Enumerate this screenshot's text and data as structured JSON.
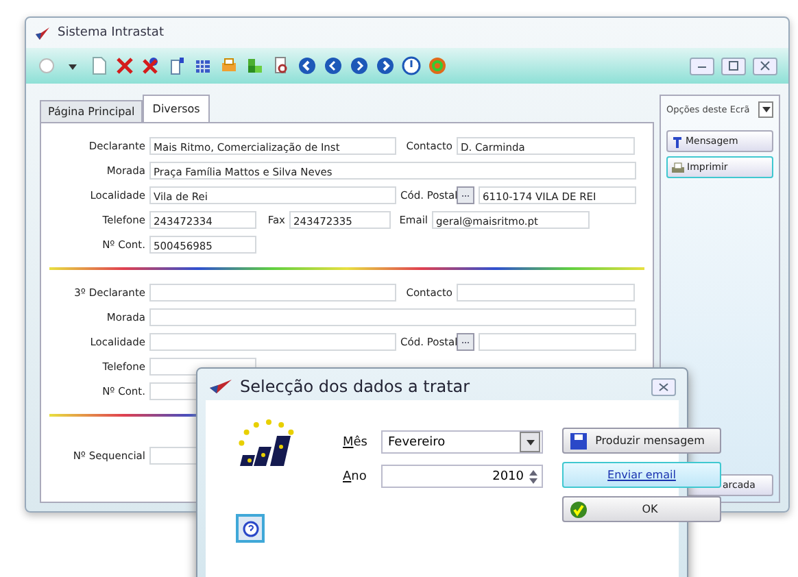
{
  "window": {
    "title": "Sistema Intrastat"
  },
  "tabs": [
    {
      "label": "Página Principal",
      "selected": false
    },
    {
      "label": "Diversos",
      "selected": true
    }
  ],
  "sections": [
    {
      "rows": [
        {
          "kind": "pair",
          "label": "Declarante",
          "value": "Mais Ritmo, Comercialização de Inst",
          "side_label": "Contacto",
          "side_value": "D. Carminda"
        },
        {
          "kind": "wide",
          "label": "Morada",
          "value": "Praça Família Mattos e Silva Neves"
        },
        {
          "kind": "postal",
          "label": "Localidade",
          "value": "Vila de Rei",
          "side_label": "Cód. Postal",
          "side_value": "6110-174 VILA DE REI"
        },
        {
          "kind": "phone",
          "label": "Telefone",
          "value": "243472334",
          "fax_label": "Fax",
          "fax": "243472335",
          "email_label": "Email",
          "email": "geral@maisritmo.pt"
        },
        {
          "kind": "single",
          "label": "Nº Cont.",
          "value": "500456985"
        }
      ]
    },
    {
      "rows": [
        {
          "kind": "pair",
          "label": "3º Declarante",
          "side_label": "Contacto"
        },
        {
          "kind": "wide",
          "label": "Morada"
        },
        {
          "kind": "postal",
          "label": "Localidade",
          "side_label": "Cód. Postal"
        },
        {
          "kind": "single",
          "label": "Telefone"
        },
        {
          "kind": "single",
          "label": "Nº Cont."
        }
      ]
    }
  ],
  "sequence": {
    "label": "Nº Sequencial"
  },
  "side_panel": {
    "dropdown": "Opções deste Ecrã",
    "buttons": [
      {
        "label": "Mensagem",
        "focused": false
      },
      {
        "label": "Imprimir",
        "focused": true
      }
    ],
    "bottom_button": "arcada"
  },
  "dialog": {
    "title": "Selecção dos dados a tratar",
    "month_label": "Mês",
    "month": "Fevereiro",
    "year_label": "Ano",
    "year": "2010",
    "buttons": [
      {
        "kind": "save",
        "label": "Produzir mensagem",
        "focused": false
      },
      {
        "kind": "plain",
        "label": "Enviar email",
        "focused": true
      },
      {
        "kind": "check",
        "label": "OK",
        "focused": false
      }
    ]
  }
}
